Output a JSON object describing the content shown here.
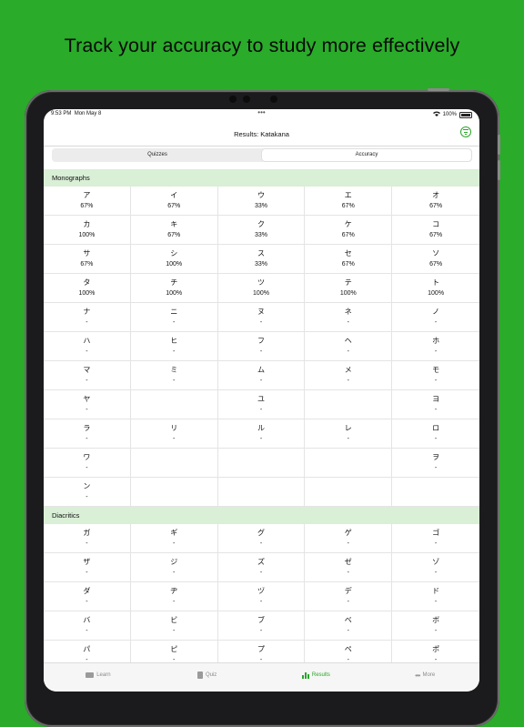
{
  "headline": "Track your accuracy to study more effectively",
  "status_bar": {
    "time": "9:53 PM",
    "date": "Mon May 8",
    "battery": "100%"
  },
  "nav": {
    "title": "Results: Katakana"
  },
  "segments": [
    {
      "label": "Quizzes",
      "active": false
    },
    {
      "label": "Accuracy",
      "active": true
    }
  ],
  "sections": [
    {
      "title": "Monographs",
      "rows": [
        [
          {
            "kana": "ア",
            "acc": "67%"
          },
          {
            "kana": "イ",
            "acc": "67%"
          },
          {
            "kana": "ウ",
            "acc": "33%"
          },
          {
            "kana": "エ",
            "acc": "67%"
          },
          {
            "kana": "オ",
            "acc": "67%"
          }
        ],
        [
          {
            "kana": "カ",
            "acc": "100%"
          },
          {
            "kana": "キ",
            "acc": "67%"
          },
          {
            "kana": "ク",
            "acc": "33%"
          },
          {
            "kana": "ケ",
            "acc": "67%"
          },
          {
            "kana": "コ",
            "acc": "67%"
          }
        ],
        [
          {
            "kana": "サ",
            "acc": "67%"
          },
          {
            "kana": "シ",
            "acc": "100%"
          },
          {
            "kana": "ス",
            "acc": "33%"
          },
          {
            "kana": "セ",
            "acc": "67%"
          },
          {
            "kana": "ソ",
            "acc": "67%"
          }
        ],
        [
          {
            "kana": "タ",
            "acc": "100%"
          },
          {
            "kana": "チ",
            "acc": "100%"
          },
          {
            "kana": "ツ",
            "acc": "100%"
          },
          {
            "kana": "テ",
            "acc": "100%"
          },
          {
            "kana": "ト",
            "acc": "100%"
          }
        ],
        [
          {
            "kana": "ナ",
            "acc": "-"
          },
          {
            "kana": "ニ",
            "acc": "-"
          },
          {
            "kana": "ヌ",
            "acc": "-"
          },
          {
            "kana": "ネ",
            "acc": "-"
          },
          {
            "kana": "ノ",
            "acc": "-"
          }
        ],
        [
          {
            "kana": "ハ",
            "acc": "-"
          },
          {
            "kana": "ヒ",
            "acc": "-"
          },
          {
            "kana": "フ",
            "acc": "-"
          },
          {
            "kana": "ヘ",
            "acc": "-"
          },
          {
            "kana": "ホ",
            "acc": "-"
          }
        ],
        [
          {
            "kana": "マ",
            "acc": "-"
          },
          {
            "kana": "ミ",
            "acc": "-"
          },
          {
            "kana": "ム",
            "acc": "-"
          },
          {
            "kana": "メ",
            "acc": "-"
          },
          {
            "kana": "モ",
            "acc": "-"
          }
        ],
        [
          {
            "kana": "ヤ",
            "acc": "-"
          },
          {
            "kana": "",
            "acc": ""
          },
          {
            "kana": "ユ",
            "acc": "-"
          },
          {
            "kana": "",
            "acc": ""
          },
          {
            "kana": "ヨ",
            "acc": "-"
          }
        ],
        [
          {
            "kana": "ラ",
            "acc": "-"
          },
          {
            "kana": "リ",
            "acc": "-"
          },
          {
            "kana": "ル",
            "acc": "-"
          },
          {
            "kana": "レ",
            "acc": "-"
          },
          {
            "kana": "ロ",
            "acc": "-"
          }
        ],
        [
          {
            "kana": "ワ",
            "acc": "-"
          },
          {
            "kana": "",
            "acc": ""
          },
          {
            "kana": "",
            "acc": ""
          },
          {
            "kana": "",
            "acc": ""
          },
          {
            "kana": "ヲ",
            "acc": "-"
          }
        ],
        [
          {
            "kana": "ン",
            "acc": "-"
          },
          {
            "kana": "",
            "acc": ""
          },
          {
            "kana": "",
            "acc": ""
          },
          {
            "kana": "",
            "acc": ""
          },
          {
            "kana": "",
            "acc": ""
          }
        ]
      ]
    },
    {
      "title": "Diacritics",
      "rows": [
        [
          {
            "kana": "ガ",
            "acc": "-"
          },
          {
            "kana": "ギ",
            "acc": "-"
          },
          {
            "kana": "グ",
            "acc": "-"
          },
          {
            "kana": "ゲ",
            "acc": "-"
          },
          {
            "kana": "ゴ",
            "acc": "-"
          }
        ],
        [
          {
            "kana": "ザ",
            "acc": "-"
          },
          {
            "kana": "ジ",
            "acc": "-"
          },
          {
            "kana": "ズ",
            "acc": "-"
          },
          {
            "kana": "ゼ",
            "acc": "-"
          },
          {
            "kana": "ゾ",
            "acc": "-"
          }
        ],
        [
          {
            "kana": "ダ",
            "acc": "-"
          },
          {
            "kana": "ヂ",
            "acc": "-"
          },
          {
            "kana": "ヅ",
            "acc": "-"
          },
          {
            "kana": "デ",
            "acc": "-"
          },
          {
            "kana": "ド",
            "acc": "-"
          }
        ],
        [
          {
            "kana": "バ",
            "acc": "-"
          },
          {
            "kana": "ビ",
            "acc": "-"
          },
          {
            "kana": "ブ",
            "acc": "-"
          },
          {
            "kana": "ベ",
            "acc": "-"
          },
          {
            "kana": "ボ",
            "acc": "-"
          }
        ],
        [
          {
            "kana": "パ",
            "acc": "-"
          },
          {
            "kana": "ピ",
            "acc": "-"
          },
          {
            "kana": "プ",
            "acc": "-"
          },
          {
            "kana": "ペ",
            "acc": "-"
          },
          {
            "kana": "ポ",
            "acc": "-"
          }
        ]
      ]
    }
  ],
  "tabs": [
    {
      "label": "Learn",
      "icon": "book-icon",
      "active": false
    },
    {
      "label": "Quiz",
      "icon": "quiz-icon",
      "active": false
    },
    {
      "label": "Results",
      "icon": "results-icon",
      "active": true
    },
    {
      "label": "More",
      "icon": "more-icon",
      "active": false
    }
  ],
  "colors": {
    "background": "#2aab2a",
    "accent": "#2aa52a",
    "section_header": "#d9efd6"
  }
}
